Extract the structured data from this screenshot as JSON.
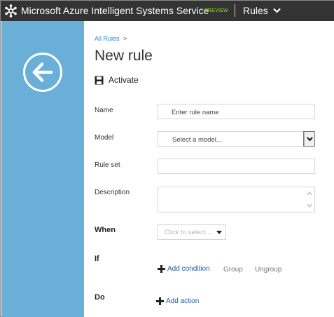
{
  "header": {
    "brand": "Microsoft Azure Intelligent Systems Service",
    "badge": "PREVIEW",
    "menu_label": "Rules"
  },
  "breadcrumb": {
    "link": "All Rules",
    "separator": ">"
  },
  "page": {
    "title": "New rule",
    "activate_label": "Activate"
  },
  "form": {
    "name": {
      "label": "Name",
      "placeholder": "Enter rule name"
    },
    "model": {
      "label": "Model",
      "selected": "Select a model..."
    },
    "ruleset": {
      "label": "Rule set",
      "value": ""
    },
    "description": {
      "label": "Description",
      "value": ""
    },
    "when": {
      "label": "When",
      "placeholder": "Click to select ..."
    },
    "if": {
      "label": "If",
      "add_condition": "Add condition",
      "group": "Group",
      "ungroup": "Ungroup"
    },
    "do": {
      "label": "Do",
      "add_action": "Add action"
    }
  },
  "icons": {
    "logo": "azure-snowflake-logo",
    "menu": "chevron-down-icon",
    "back": "arrow-left-icon",
    "activate": "save-icon",
    "add": "plus-icon"
  },
  "colors": {
    "topbar": "#333333",
    "sidepanel": "#6aafd8",
    "badge": "#7bb81b",
    "link": "#2e84c4",
    "action_link": "#1e5aa8"
  }
}
